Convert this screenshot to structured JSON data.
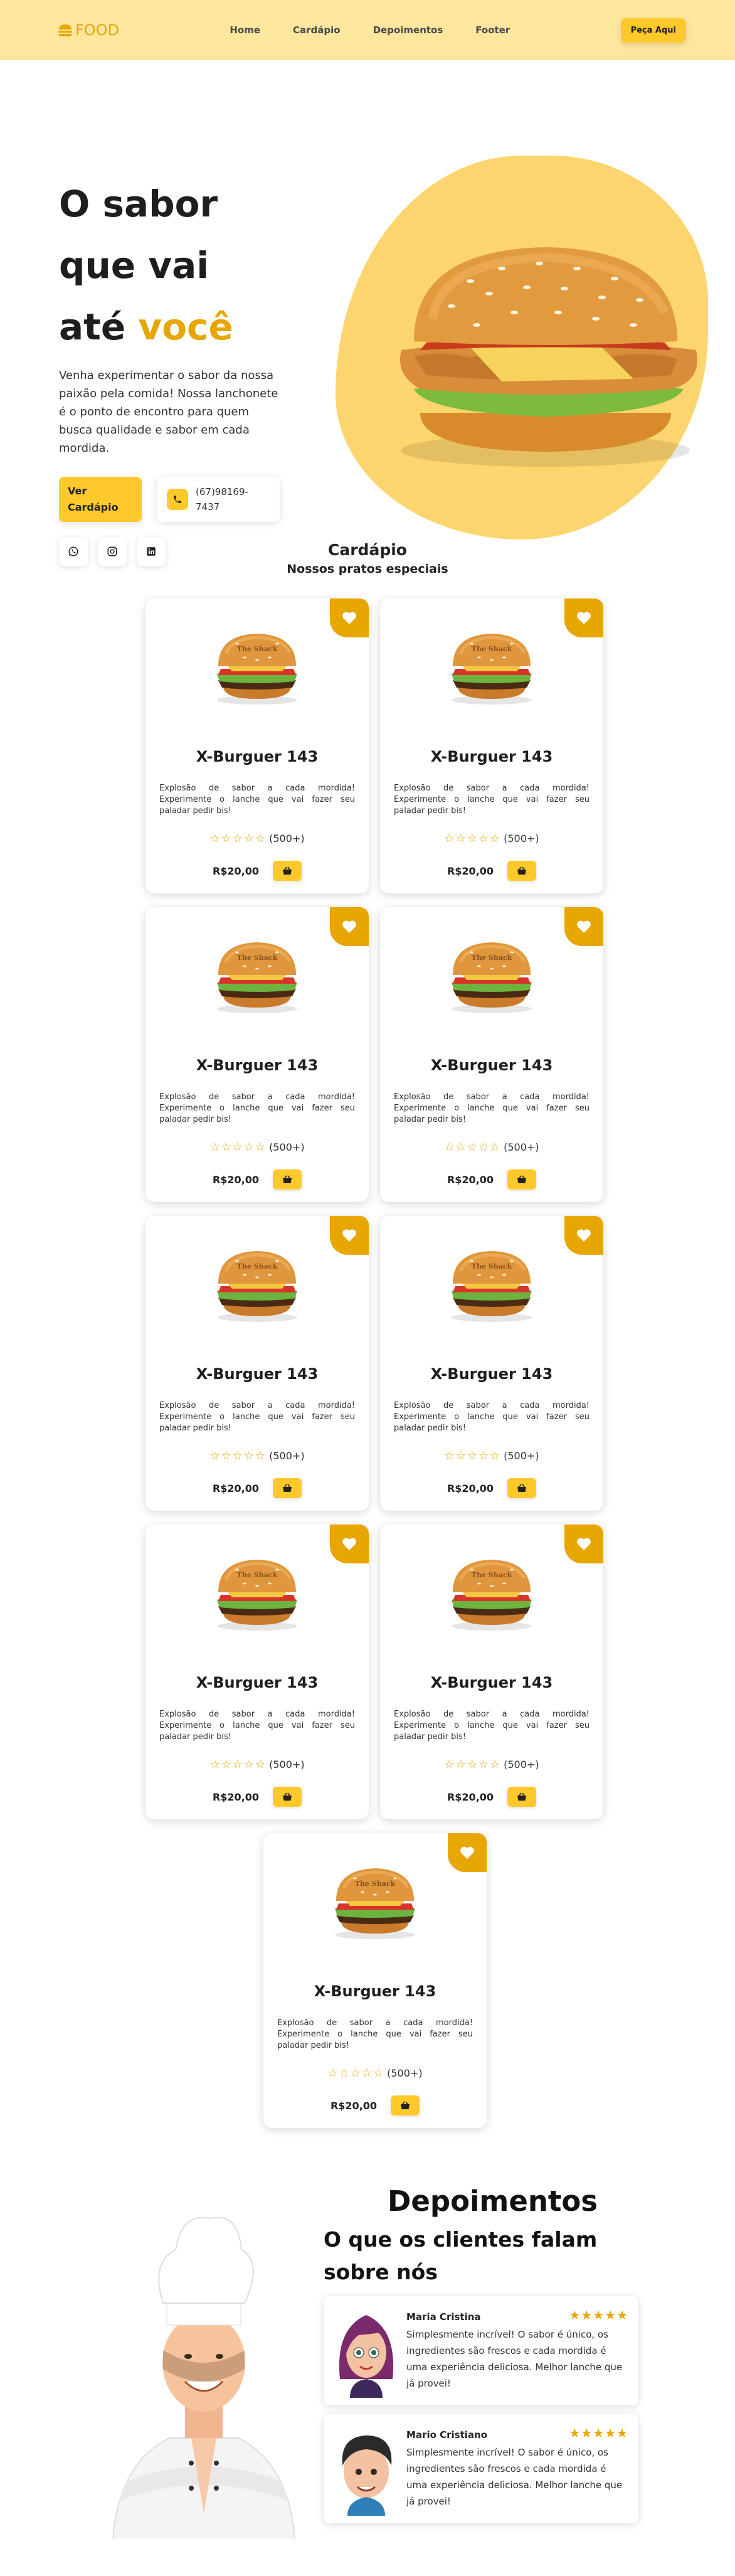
{
  "header": {
    "logo_text": "FOOD",
    "nav": [
      "Home",
      "Cardápio",
      "Depoimentos",
      "Footer"
    ],
    "cta": "Peça Aqui"
  },
  "hero": {
    "title_line1": "O sabor",
    "title_line2": "que vai",
    "title_line3_plain": "até ",
    "title_line3_accent": "você",
    "description": "Venha experimentar o sabor da nossa paixão pela comida! Nossa lanchonete é o ponto de encontro para quem busca qualidade e sabor em cada mordida.",
    "menu_button": "Ver Cardápio",
    "phone": "(67)98169-7437",
    "social_icons": [
      "whatsapp-icon",
      "instagram-icon",
      "linkedin-icon"
    ]
  },
  "menu": {
    "title": "Cardápio",
    "subtitle": "Nossos pratos especiais",
    "items": [
      {
        "name": "X-Burguer 143",
        "description": "Explosão de sabor a cada mordida! Experimente o lanche que vai fazer seu paladar pedir bis!",
        "rating_count": "(500+)",
        "price": "R$20,00"
      },
      {
        "name": "X-Burguer 143",
        "description": "Explosão de sabor a cada mordida! Experimente o lanche que vai fazer seu paladar pedir bis!",
        "rating_count": "(500+)",
        "price": "R$20,00"
      },
      {
        "name": "X-Burguer 143",
        "description": "Explosão de sabor a cada mordida! Experimente o lanche que vai fazer seu paladar pedir bis!",
        "rating_count": "(500+)",
        "price": "R$20,00"
      },
      {
        "name": "X-Burguer 143",
        "description": "Explosão de sabor a cada mordida! Experimente o lanche que vai fazer seu paladar pedir bis!",
        "rating_count": "(500+)",
        "price": "R$20,00"
      },
      {
        "name": "X-Burguer 143",
        "description": "Explosão de sabor a cada mordida! Experimente o lanche que vai fazer seu paladar pedir bis!",
        "rating_count": "(500+)",
        "price": "R$20,00"
      },
      {
        "name": "X-Burguer 143",
        "description": "Explosão de sabor a cada mordida! Experimente o lanche que vai fazer seu paladar pedir bis!",
        "rating_count": "(500+)",
        "price": "R$20,00"
      },
      {
        "name": "X-Burguer 143",
        "description": "Explosão de sabor a cada mordida! Experimente o lanche que vai fazer seu paladar pedir bis!",
        "rating_count": "(500+)",
        "price": "R$20,00"
      },
      {
        "name": "X-Burguer 143",
        "description": "Explosão de sabor a cada mordida! Experimente o lanche que vai fazer seu paladar pedir bis!",
        "rating_count": "(500+)",
        "price": "R$20,00"
      },
      {
        "name": "X-Burguer 143",
        "description": "Explosão de sabor a cada mordida! Experimente o lanche que vai fazer seu paladar pedir bis!",
        "rating_count": "(500+)",
        "price": "R$20,00"
      }
    ],
    "stars_empty": "☆☆☆☆☆"
  },
  "testimonials": {
    "title": "Depoimentos",
    "subtitle": "O que os clientes falam sobre nós",
    "items": [
      {
        "name": "Maria Cristina",
        "stars": "★★★★★",
        "text": "Simplesmente incrível! O sabor é único, os ingredientes são frescos e cada mordida é uma experiência deliciosa. Melhor lanche que já provei!"
      },
      {
        "name": "Mario Cristiano",
        "stars": "★★★★★",
        "text": "Simplesmente incrível! O sabor é único, os ingredientes são frescos e cada mordida é uma experiência deliciosa. Melhor lanche que já provei!"
      }
    ]
  },
  "colors": {
    "accent": "#e7a600",
    "button": "#ffc82b",
    "header_bg": "#fde79e",
    "hero_blob": "#fdd56e"
  }
}
